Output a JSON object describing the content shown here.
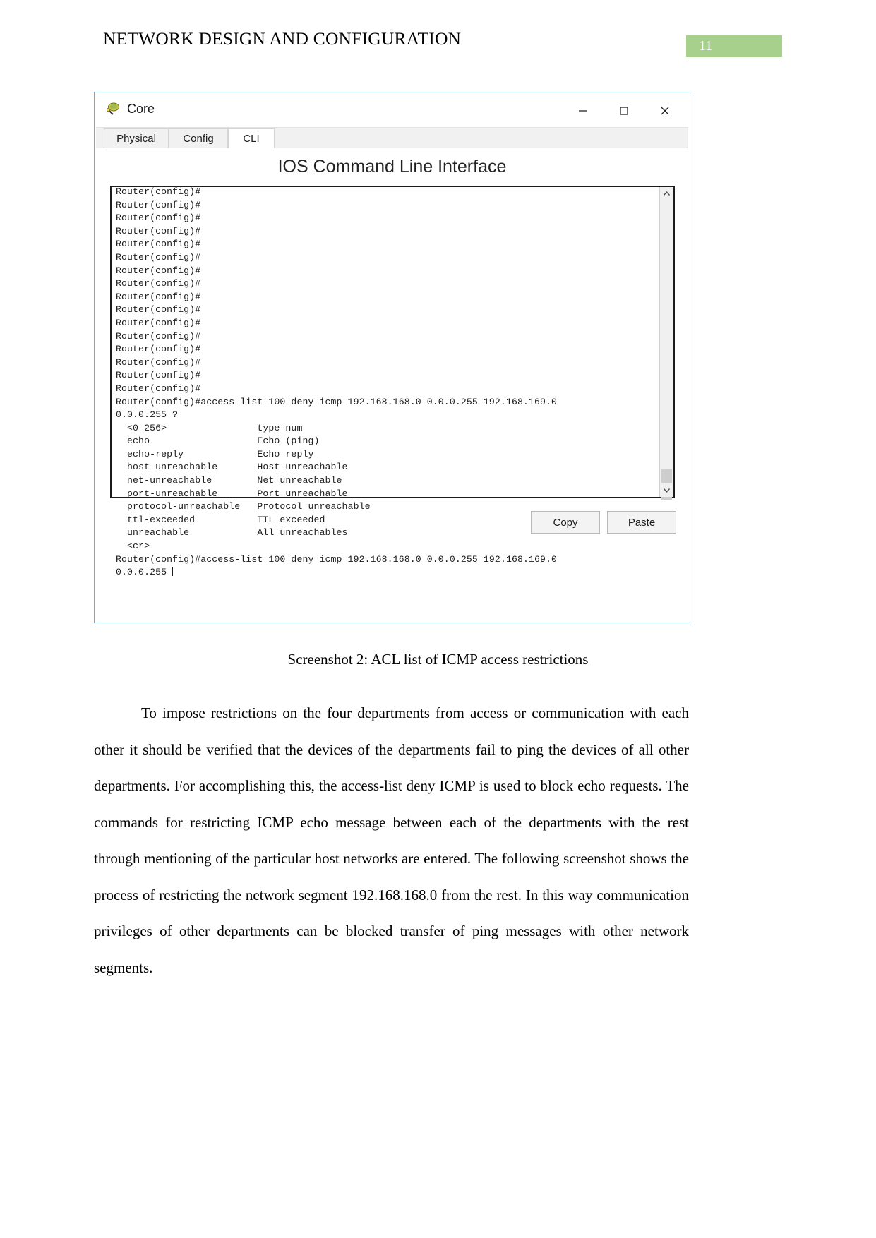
{
  "document": {
    "header_title": "NETWORK DESIGN AND CONFIGURATION",
    "page_number": "11",
    "page_badge_color": "#a8d08d",
    "caption": "Screenshot 2: ACL list of ICMP access restrictions",
    "body_paragraph": "To impose restrictions on the four departments from access or communication with each other it should be verified that the devices of the departments fail to ping the devices of all other departments. For accomplishing this, the access-list deny ICMP is used to block echo requests. The commands for restricting ICMP echo message between each of the departments with the rest through mentioning of the particular host networks are entered. The following screenshot shows the process of restricting the network segment 192.168.168.0 from the rest. In this way communication privileges of other departments can be blocked transfer of ping messages with other network segments."
  },
  "window": {
    "title": "Core",
    "icon": "packet-tracer-router-icon",
    "controls": {
      "minimize": "—",
      "maximize": "□",
      "close": "✕"
    },
    "tabs": [
      {
        "label": "Physical",
        "active": false
      },
      {
        "label": "Config",
        "active": false
      },
      {
        "label": "CLI",
        "active": true
      }
    ],
    "cli": {
      "heading": "IOS Command Line Interface",
      "terminal_text": "Router(config)#\nRouter(config)#\nRouter(config)#\nRouter(config)#\nRouter(config)#\nRouter(config)#\nRouter(config)#\nRouter(config)#\nRouter(config)#\nRouter(config)#\nRouter(config)#\nRouter(config)#\nRouter(config)#\nRouter(config)#\nRouter(config)#\nRouter(config)#\nRouter(config)#access-list 100 deny icmp 192.168.168.0 0.0.0.255 192.168.169.0\n0.0.0.255 ?\n  <0-256>                type-num\n  echo                   Echo (ping)\n  echo-reply             Echo reply\n  host-unreachable       Host unreachable\n  net-unreachable        Net unreachable\n  port-unreachable       Port unreachable\n  protocol-unreachable   Protocol unreachable\n  ttl-exceeded           TTL exceeded\n  unreachable            All unreachables\n  <cr>\nRouter(config)#access-list 100 deny icmp 192.168.168.0 0.0.0.255 192.168.169.0\n0.0.0.255 ",
      "buttons": {
        "copy": "Copy",
        "paste": "Paste"
      },
      "scrollbar": {
        "up_arrow": "∧",
        "down_arrow": "∨"
      }
    }
  }
}
